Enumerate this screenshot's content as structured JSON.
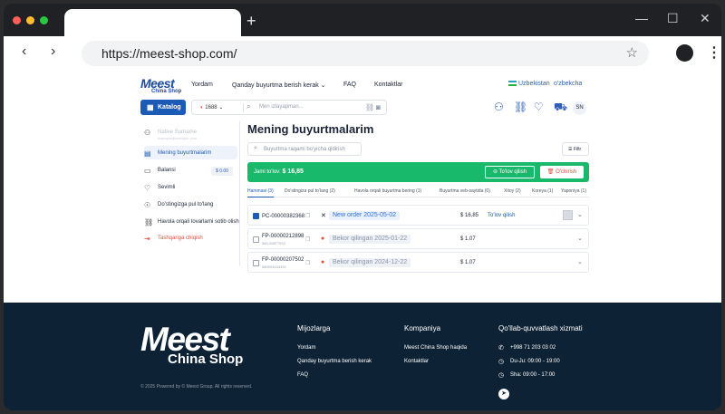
{
  "browser": {
    "url": "https://meest-shop.com/",
    "new_tab": "+",
    "star": "☆"
  },
  "header": {
    "logo_main": "Meest",
    "logo_sub": "China Shop",
    "nav": [
      "Yordam",
      "Qanday buyurtma berish kerak",
      "FAQ",
      "Kontaktlar"
    ],
    "country": "Uzbekistan",
    "language": "o'zbekcha",
    "catalog": "Katalog",
    "source_site": "1688",
    "search_placeholder": "Men izlayapman...",
    "avatar_initials": "SN"
  },
  "sidebar": {
    "user_name": "Native Surname",
    "user_email": "example@example.com",
    "items": [
      {
        "label": "Mening buyurtmalarim",
        "icon": "clipboard-icon"
      },
      {
        "label": "Balansi",
        "icon": "wallet-icon",
        "badge": "$ 0.00"
      },
      {
        "label": "Sevimli",
        "icon": "heart-icon"
      },
      {
        "label": "Do'stingizga pul to'lang",
        "icon": "hand-coin-icon"
      },
      {
        "label": "Havola orqali tovarlarni sotib olish",
        "icon": "link-icon"
      },
      {
        "label": "Tashqariga chiqish",
        "icon": "logout-icon"
      }
    ]
  },
  "main": {
    "title": "Mening buyurtmalarim",
    "search_placeholder": "Buyurtma raqami bo'yicha qidirish",
    "filter": "Filtr",
    "total_label": "Jami to'lov:",
    "total_value": "$ 16,85",
    "pay_button": "To'lov qilish",
    "delete_button": "O'chirish",
    "tabs": [
      "Hammasi (3)",
      "Do'stingiza pul to'lang (2)",
      "Havola orqali buyurtma bering (1)",
      "Buyurtma veb-saytida (0)",
      "Xitoy (2)",
      "Koreya (1)",
      "Yaponiya (1)"
    ],
    "orders": [
      {
        "number": "PC-00000382368",
        "sub": "",
        "status": "New order 2025-05-02",
        "price": "$ 16,85",
        "action": "To'lov qilish",
        "checked": true,
        "status_color": "#2d6fd8",
        "status_bg": "#eaf1fd"
      },
      {
        "number": "FP-00000212898",
        "sub": "380-09877532",
        "status": "Bekor qilingan 2025-01-22",
        "price": "$ 1.07",
        "action": "",
        "checked": false,
        "status_color": "#8a94a6",
        "status_bg": "#eef1f6"
      },
      {
        "number": "FP-00000207502",
        "sub": "380904443332",
        "status": "Bekor qilingan 2024-12-22",
        "price": "$ 1.07",
        "action": "",
        "checked": false,
        "status_color": "#8a94a6",
        "status_bg": "#eef1f6"
      }
    ]
  },
  "footer": {
    "logo_main": "Meest",
    "logo_sub": "China Shop",
    "copyright": "© 2025 Powered by © Meest Group. All rights reserved.",
    "col1_title": "Mijozlarga",
    "col1_links": [
      "Yordam",
      "Qanday buyurtma berish kerak",
      "FAQ"
    ],
    "col2_title": "Kompaniya",
    "col2_links": [
      "Meest China Shop haqida",
      "Kontaktlar"
    ],
    "col3_title": "Qo'llab-quvvatlash xizmati",
    "phone": "+998 71 203 03 02",
    "hours1": "Du-Ju: 09:00 - 19:00",
    "hours2": "Sha: 09:00 - 17:00"
  },
  "colors": {
    "accent": "#1c5bb5",
    "success": "#18b96b",
    "danger": "#e24b3b",
    "footer_bg": "#0e2235"
  }
}
